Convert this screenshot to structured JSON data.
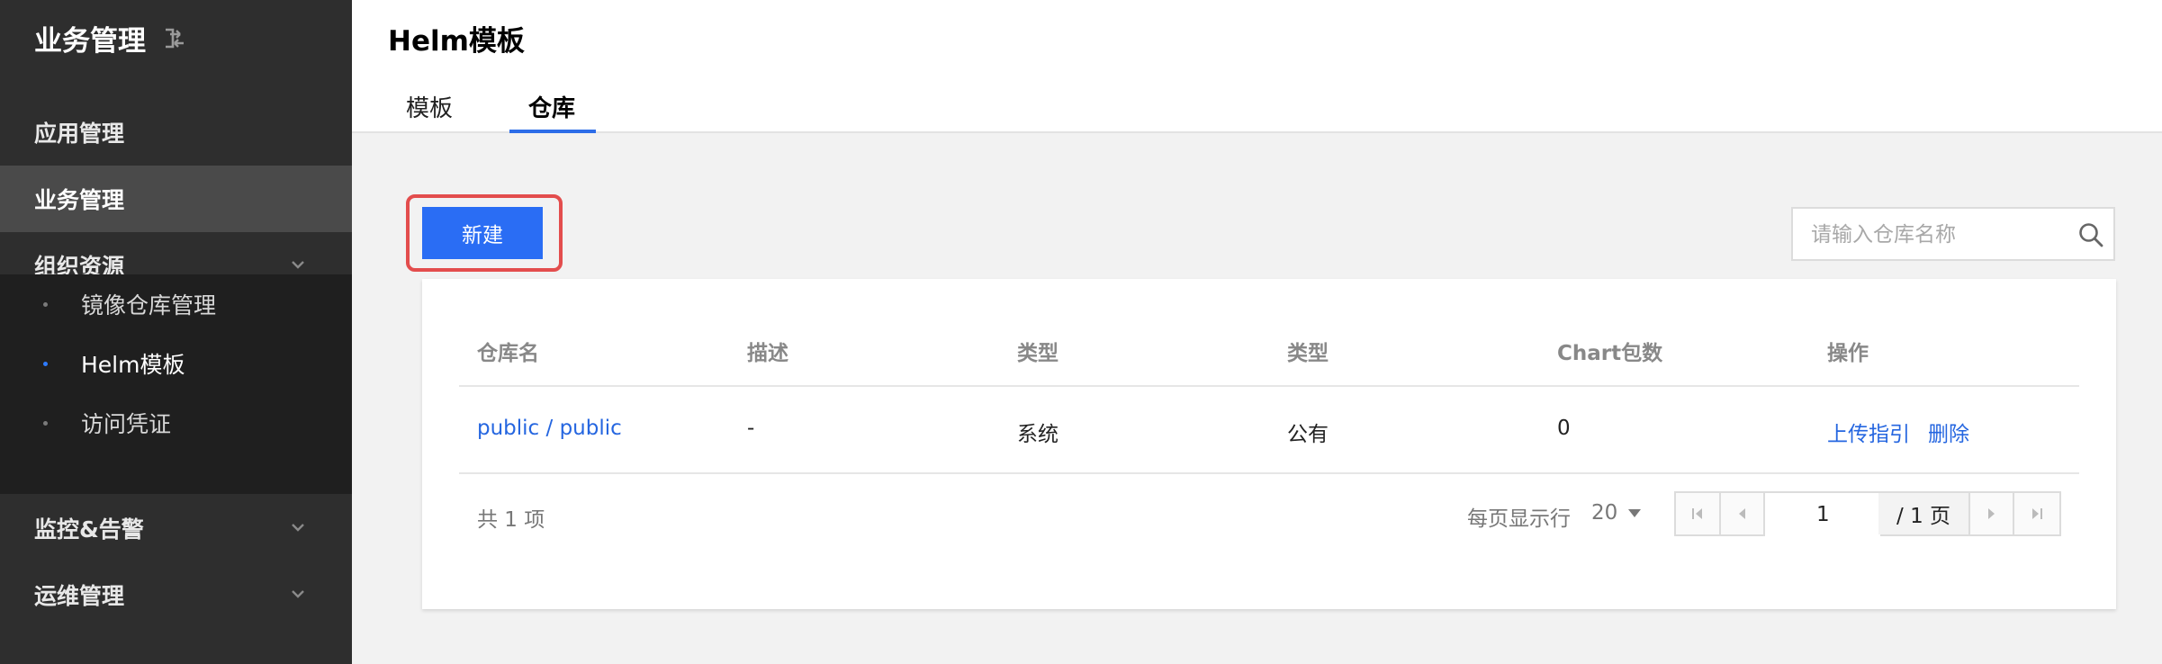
{
  "sidebar": {
    "title": "业务管理",
    "items": [
      {
        "label": "应用管理"
      },
      {
        "label": "业务管理"
      },
      {
        "label": "组织资源"
      },
      {
        "label": "监控&告警"
      },
      {
        "label": "运维管理"
      }
    ],
    "sub_items": [
      {
        "label": "镜像仓库管理"
      },
      {
        "label": "Helm模板"
      },
      {
        "label": "访问凭证"
      }
    ]
  },
  "header": {
    "title": "Helm模板",
    "tabs": [
      {
        "label": "模板"
      },
      {
        "label": "仓库"
      }
    ]
  },
  "toolbar": {
    "new_label": "新建",
    "search_placeholder": "请输入仓库名称"
  },
  "table": {
    "columns": [
      "仓库名",
      "描述",
      "类型",
      "类型",
      "Chart包数",
      "操作"
    ],
    "rows": [
      {
        "name": "public / public",
        "description": "-",
        "type1": "系统",
        "type2": "公有",
        "chart_count": "0",
        "actions": [
          "上传指引",
          "删除"
        ]
      }
    ]
  },
  "pagination": {
    "total_text": "共 1 项",
    "page_size_label": "每页显示行",
    "page_size": "20",
    "current_page": "1",
    "total_pages_text": "/ 1 页"
  },
  "colors": {
    "sidebar_bg": "#2e2e2e",
    "primary": "#2a6df4",
    "link": "#2566e0",
    "highlight": "#e34d4d"
  }
}
